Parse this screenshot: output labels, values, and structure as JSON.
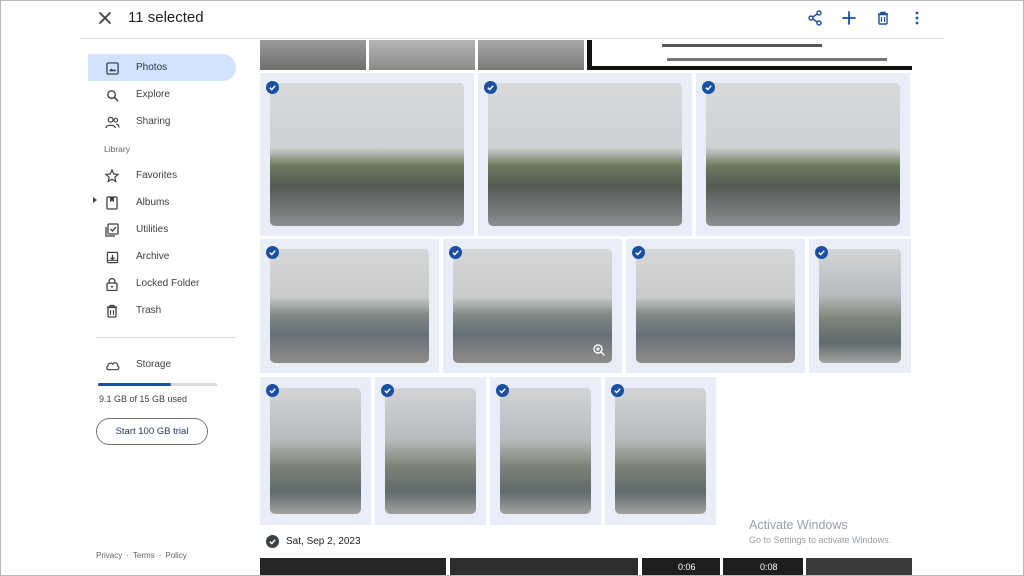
{
  "header": {
    "selection_title": "11 selected",
    "actions": [
      "share-icon",
      "add-icon",
      "trash-icon",
      "more-vert-icon"
    ]
  },
  "sidebar": {
    "items": [
      {
        "label": "Photos",
        "icon": "photos-icon",
        "active": true
      },
      {
        "label": "Explore",
        "icon": "search-icon"
      },
      {
        "label": "Sharing",
        "icon": "people-icon"
      }
    ],
    "library_label": "Library",
    "library_items": [
      {
        "label": "Favorites",
        "icon": "star-icon"
      },
      {
        "label": "Albums",
        "icon": "album-icon"
      },
      {
        "label": "Utilities",
        "icon": "utilities-icon"
      },
      {
        "label": "Archive",
        "icon": "archive-icon"
      },
      {
        "label": "Locked Folder",
        "icon": "lock-icon"
      },
      {
        "label": "Trash",
        "icon": "trash-icon"
      }
    ],
    "storage": {
      "label": "Storage",
      "used_text": "9.1 GB of 15 GB used",
      "used_fraction": 0.61,
      "trial_button": "Start 100 GB trial"
    },
    "footer": {
      "privacy": "Privacy",
      "sep": "·",
      "terms": "Terms",
      "policy": "Policy"
    }
  },
  "grid": {
    "selected_count": 11,
    "next_date": "Sat, Sep 2, 2023",
    "video_durations": [
      "0:06",
      "0:08"
    ]
  },
  "watermark": {
    "title": "Activate Windows",
    "subtitle": "Go to Settings to activate Windows."
  },
  "colors": {
    "accent": "#1a4fa3",
    "selected_nav_bg": "#d3e3fd",
    "tile_bg": "#e8edf8"
  }
}
